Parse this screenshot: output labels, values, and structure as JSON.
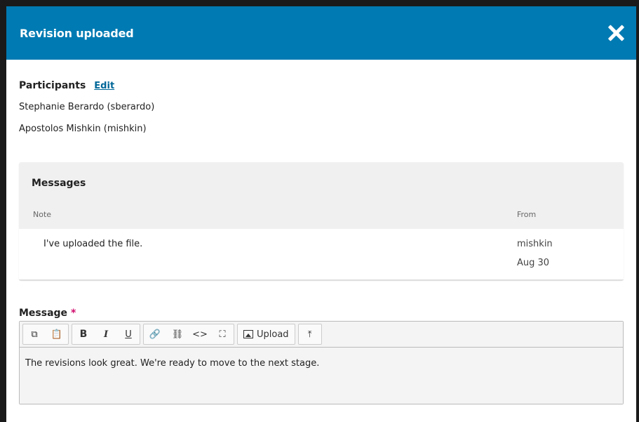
{
  "modal": {
    "title": "Revision uploaded",
    "close_icon": "close-icon"
  },
  "participants": {
    "heading": "Participants",
    "edit_label": "Edit",
    "list": [
      "Stephanie Berardo (sberardo)",
      "Apostolos Mishkin (mishkin)"
    ]
  },
  "messages": {
    "heading": "Messages",
    "columns": {
      "note": "Note",
      "from": "From"
    },
    "rows": [
      {
        "note": "I've uploaded the file.",
        "from_user": "mishkin",
        "date": "Aug 30"
      }
    ]
  },
  "message_field": {
    "label": "Message",
    "required_marker": "*",
    "value": "The revisions look great. We're ready to move to the next stage.",
    "toolbar": {
      "copy": "⧉",
      "paste": "📋",
      "bold": "B",
      "italic": "I",
      "underline": "U",
      "link": "🔗",
      "unlink": "⛓",
      "code": "<>",
      "fullscreen": "⛶",
      "upload_label": "Upload",
      "import": "⤒"
    }
  },
  "colors": {
    "header": "#007ab2",
    "link": "#006798",
    "required": "#d00a6c"
  }
}
